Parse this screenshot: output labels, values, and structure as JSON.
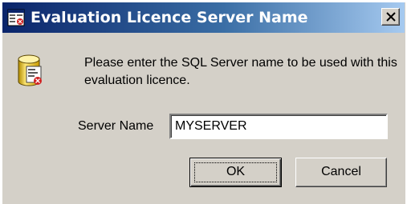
{
  "window": {
    "title": "Evaluation Licence Server Name",
    "title_icon": "app-window-icon",
    "close_icon": "close-icon"
  },
  "dialog": {
    "icon": "database-icon",
    "message": "Please enter the SQL Server name to be used with this evaluation licence.",
    "server_name_label": "Server Name",
    "server_name_value": "MYSERVER"
  },
  "buttons": {
    "ok_label": "OK",
    "cancel_label": "Cancel"
  },
  "colors": {
    "titlebar_start": "#0a246a",
    "titlebar_end": "#a6caf0",
    "face": "#d4d0c8"
  }
}
